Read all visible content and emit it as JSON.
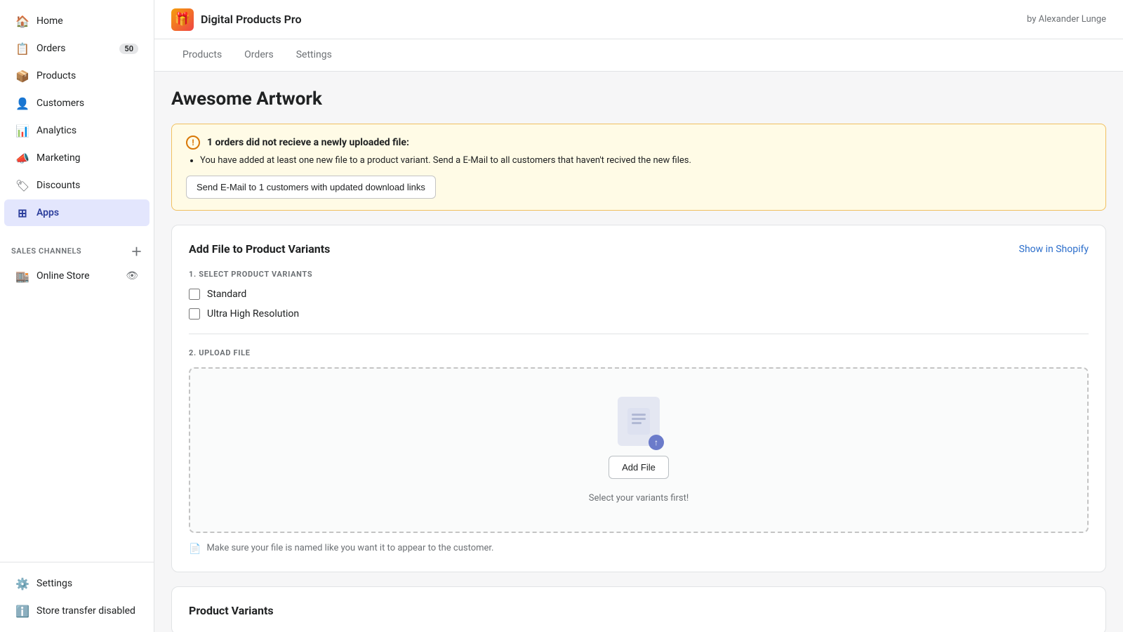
{
  "sidebar": {
    "nav_items": [
      {
        "id": "home",
        "label": "Home",
        "icon": "🏠",
        "active": false
      },
      {
        "id": "orders",
        "label": "Orders",
        "icon": "📋",
        "badge": "50",
        "active": false
      },
      {
        "id": "products",
        "label": "Products",
        "icon": "📦",
        "active": false
      },
      {
        "id": "customers",
        "label": "Customers",
        "icon": "👤",
        "active": false
      },
      {
        "id": "analytics",
        "label": "Analytics",
        "icon": "📊",
        "active": false
      },
      {
        "id": "marketing",
        "label": "Marketing",
        "icon": "📣",
        "active": false
      },
      {
        "id": "discounts",
        "label": "Discounts",
        "icon": "🏷",
        "active": false
      },
      {
        "id": "apps",
        "label": "Apps",
        "icon": "⊞",
        "active": true
      }
    ],
    "sales_channels_label": "SALES CHANNELS",
    "sales_channels": [
      {
        "id": "online-store",
        "label": "Online Store",
        "icon": "🏬"
      }
    ],
    "bottom_items": [
      {
        "id": "settings",
        "label": "Settings",
        "icon": "⚙️"
      },
      {
        "id": "store-transfer",
        "label": "Store transfer disabled",
        "icon": "ℹ️"
      }
    ]
  },
  "app_header": {
    "app_icon": "🎁",
    "app_title": "Digital Products Pro",
    "by_author": "by Alexander Lunge"
  },
  "tabs": [
    {
      "id": "products",
      "label": "Products",
      "active": false
    },
    {
      "id": "orders",
      "label": "Orders",
      "active": false
    },
    {
      "id": "settings",
      "label": "Settings",
      "active": false
    }
  ],
  "page": {
    "title": "Awesome Artwork",
    "warning": {
      "title": "1 orders did not recieve a newly uploaded file:",
      "body": "You have added at least one new file to a product variant. Send a E-Mail to all customers that haven't recived the new files.",
      "button_label": "Send E-Mail to 1 customers with updated download links"
    },
    "card": {
      "title": "Add File to Product Variants",
      "show_in_shopify_link": "Show in Shopify",
      "step1_label": "1. SELECT PRODUCT VARIANTS",
      "variants": [
        {
          "id": "standard",
          "label": "Standard"
        },
        {
          "id": "ultra-high-resolution",
          "label": "Ultra High Resolution"
        }
      ],
      "step2_label": "2. UPLOAD FILE",
      "upload": {
        "add_file_button": "Add File",
        "hint": "Select your variants first!"
      },
      "note": "Make sure your file is named like you want it to appear to the customer."
    },
    "product_variants_section": {
      "title": "Product Variants"
    }
  }
}
